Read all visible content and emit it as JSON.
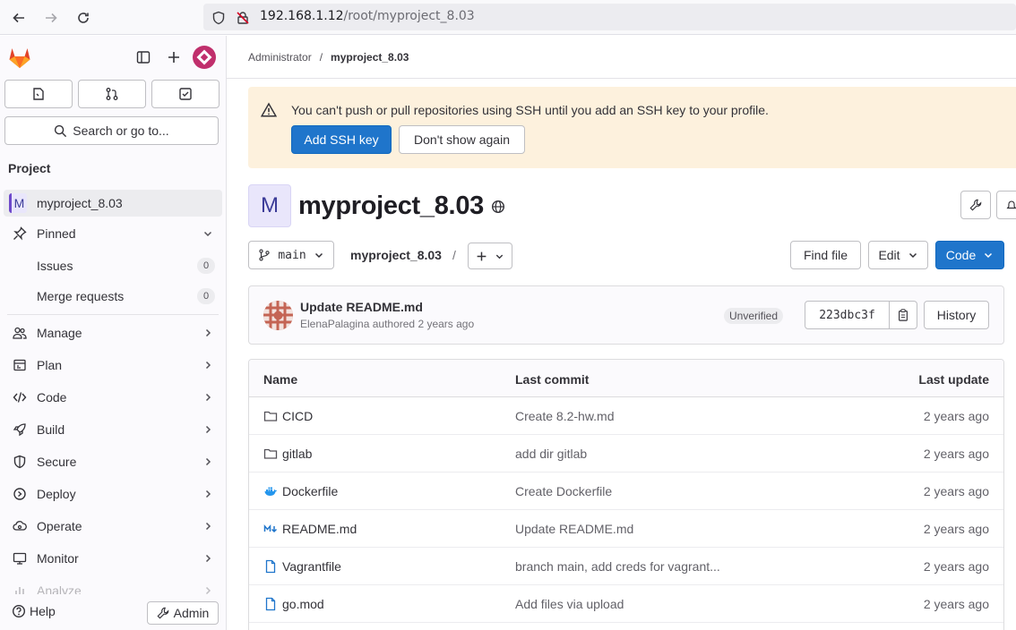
{
  "browser": {
    "url_host": "192.168.1.12",
    "url_path": "/root/myproject_8.03"
  },
  "sidebar": {
    "section_title": "Project",
    "search_label": "Search or go to...",
    "project": {
      "avatar_letter": "M",
      "name": "myproject_8.03"
    },
    "pinned": {
      "label": "Pinned",
      "items": [
        {
          "label": "Issues",
          "count": "0"
        },
        {
          "label": "Merge requests",
          "count": "0"
        }
      ]
    },
    "nav": [
      {
        "label": "Manage",
        "icon": "users-icon"
      },
      {
        "label": "Plan",
        "icon": "planning-icon"
      },
      {
        "label": "Code",
        "icon": "code-icon"
      },
      {
        "label": "Build",
        "icon": "rocket-icon"
      },
      {
        "label": "Secure",
        "icon": "shield-icon"
      },
      {
        "label": "Deploy",
        "icon": "deployments-icon"
      },
      {
        "label": "Operate",
        "icon": "cloud-gear-icon"
      },
      {
        "label": "Monitor",
        "icon": "monitor-icon"
      },
      {
        "label": "Analyze",
        "icon": "chart-icon"
      }
    ],
    "help_label": "Help",
    "admin_label": "Admin"
  },
  "breadcrumb": {
    "parent": "Administrator",
    "separator": "/",
    "current": "myproject_8.03"
  },
  "alert": {
    "message": "You can't push or pull repositories using SSH until you add an SSH key to your profile.",
    "primary_label": "Add SSH key",
    "secondary_label": "Don't show again"
  },
  "project": {
    "avatar_letter": "M",
    "title": "myproject_8.03",
    "visibility_icon": "globe-icon"
  },
  "toolbar": {
    "branch": "main",
    "repo_name": "myproject_8.03",
    "path_separator": "/",
    "find_file_label": "Find file",
    "edit_label": "Edit",
    "code_label": "Code"
  },
  "last_commit": {
    "title": "Update README.md",
    "meta": "ElenaPalagina authored 2 years ago",
    "status": "Unverified",
    "sha": "223dbc3f",
    "history_label": "History"
  },
  "files": {
    "headers": {
      "name": "Name",
      "commit": "Last commit",
      "update": "Last update"
    },
    "rows": [
      {
        "name": "CICD",
        "icon": "folder-icon",
        "commit": "Create 8.2-hw.md",
        "date": "2 years ago"
      },
      {
        "name": "gitlab",
        "icon": "folder-icon",
        "commit": "add dir gitlab",
        "date": "2 years ago"
      },
      {
        "name": "Dockerfile",
        "icon": "docker-icon",
        "commit": "Create Dockerfile",
        "date": "2 years ago"
      },
      {
        "name": "README.md",
        "icon": "markdown-icon",
        "commit": "Update README.md",
        "date": "2 years ago"
      },
      {
        "name": "Vagrantfile",
        "icon": "file-icon",
        "commit": "branch main, add creds for vagrant...",
        "date": "2 years ago"
      },
      {
        "name": "go.mod",
        "icon": "file-icon",
        "commit": "Add files via upload",
        "date": "2 years ago"
      }
    ]
  },
  "colors": {
    "brand": "#fc6d26",
    "primary": "#1f75cb",
    "alert_bg": "#fdf1dd",
    "docker_blue": "#2496ed"
  }
}
